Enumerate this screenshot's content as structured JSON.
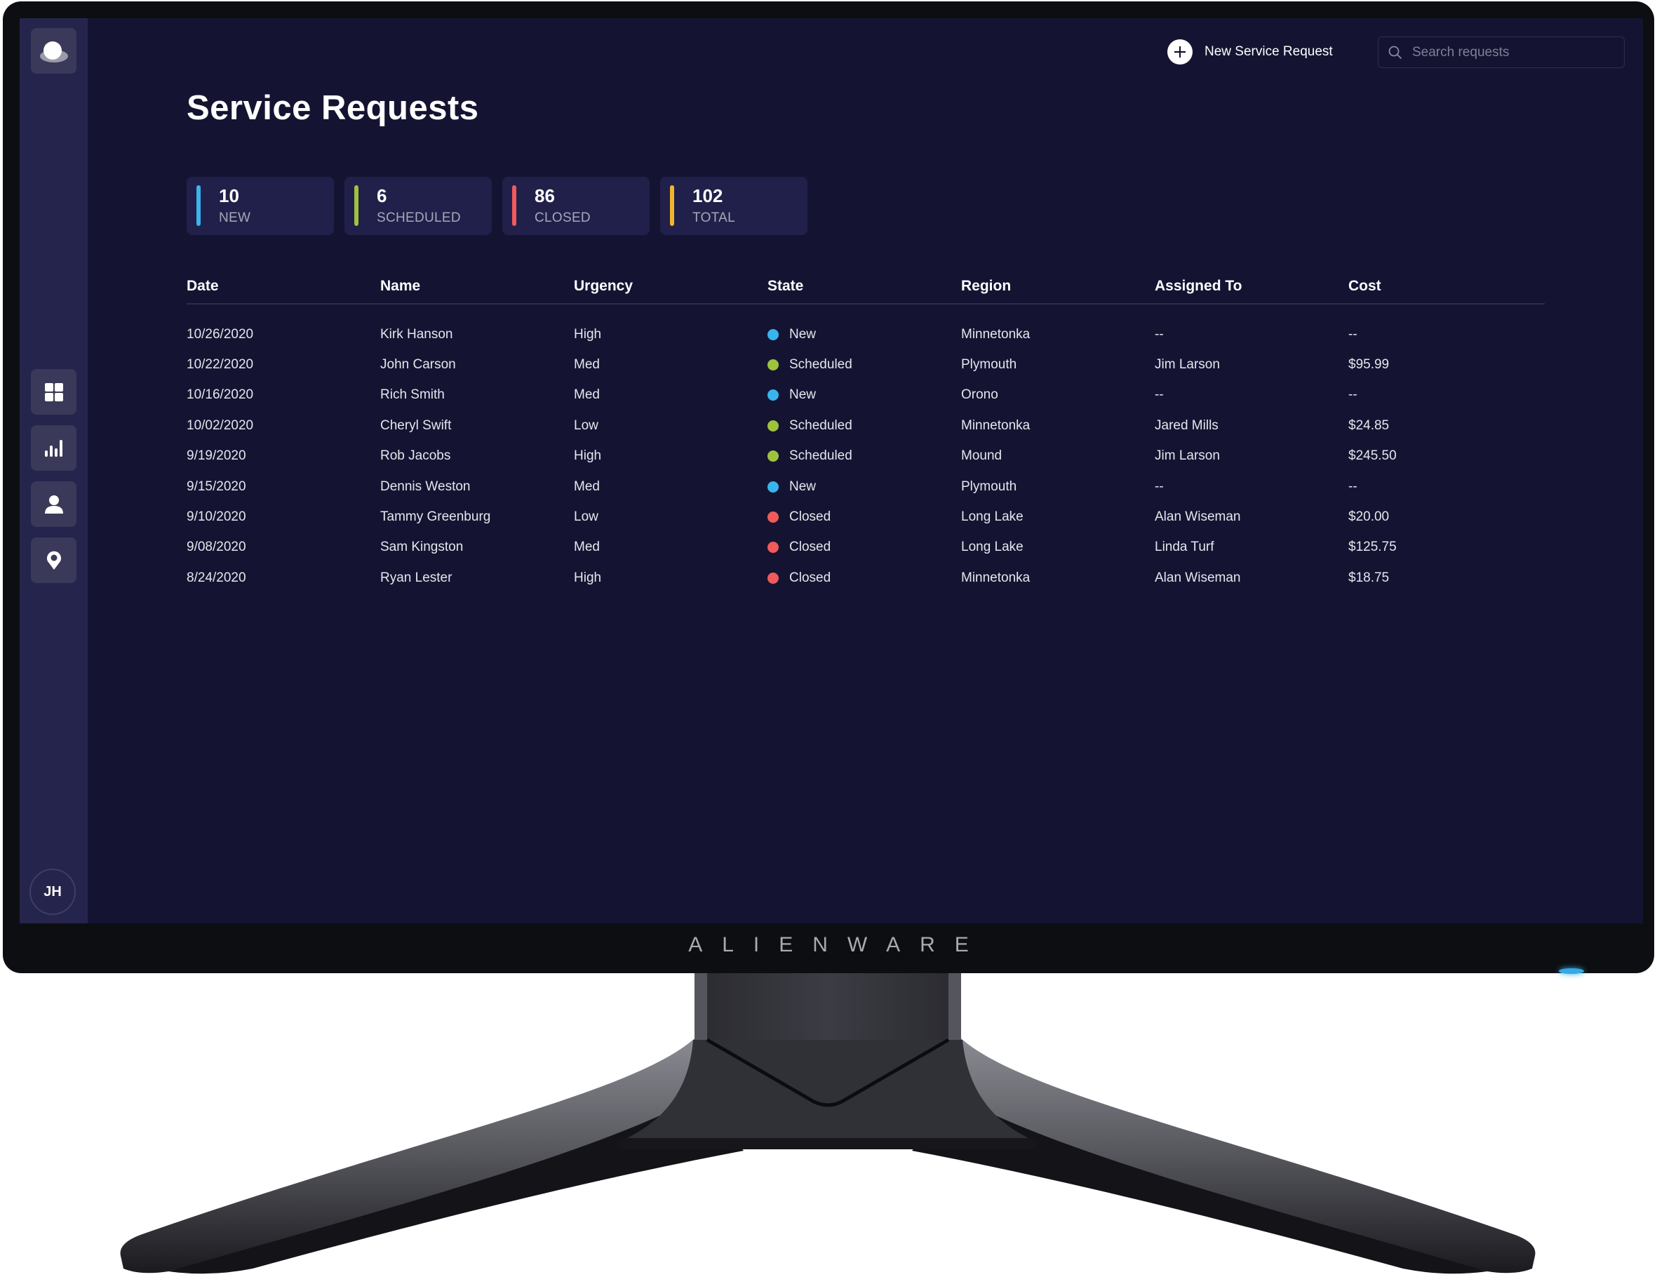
{
  "app": {
    "title": "Service Requests"
  },
  "header": {
    "new_request_label": "New Service Request",
    "search_placeholder": "Search requests",
    "search_value": ""
  },
  "sidebar": {
    "logo": "cloud-logo-icon",
    "items": [
      {
        "icon": "dashboard-grid-icon",
        "label": "Dashboard"
      },
      {
        "icon": "bar-chart-icon",
        "label": "Reports"
      },
      {
        "icon": "user-icon",
        "label": "Users"
      },
      {
        "icon": "location-pin-icon",
        "label": "Locations"
      }
    ],
    "avatar_initials": "JH"
  },
  "stats": [
    {
      "value": "10",
      "label": "NEW",
      "color": "#3ab4ec"
    },
    {
      "value": "6",
      "label": "SCHEDULED",
      "color": "#9ec23c"
    },
    {
      "value": "86",
      "label": "CLOSED",
      "color": "#ef5a5a"
    },
    {
      "value": "102",
      "label": "TOTAL",
      "color": "#f1b52c"
    }
  ],
  "state_colors": {
    "New": "#3ab4ec",
    "Scheduled": "#9ec23c",
    "Closed": "#ef5a5a"
  },
  "table": {
    "columns": [
      "Date",
      "Name",
      "Urgency",
      "State",
      "Region",
      "Assigned To",
      "Cost"
    ],
    "rows": [
      {
        "date": "10/26/2020",
        "name": "Kirk Hanson",
        "urgency": "High",
        "state": "New",
        "region": "Minnetonka",
        "assigned": "--",
        "cost": "--"
      },
      {
        "date": "10/22/2020",
        "name": "John Carson",
        "urgency": "Med",
        "state": "Scheduled",
        "region": "Plymouth",
        "assigned": "Jim Larson",
        "cost": "$95.99"
      },
      {
        "date": "10/16/2020",
        "name": "Rich Smith",
        "urgency": "Med",
        "state": "New",
        "region": "Orono",
        "assigned": "--",
        "cost": "--"
      },
      {
        "date": "10/02/2020",
        "name": "Cheryl Swift",
        "urgency": "Low",
        "state": "Scheduled",
        "region": "Minnetonka",
        "assigned": "Jared Mills",
        "cost": "$24.85"
      },
      {
        "date": "9/19/2020",
        "name": "Rob Jacobs",
        "urgency": "High",
        "state": "Scheduled",
        "region": "Mound",
        "assigned": "Jim Larson",
        "cost": "$245.50"
      },
      {
        "date": "9/15/2020",
        "name": "Dennis Weston",
        "urgency": "Med",
        "state": "New",
        "region": "Plymouth",
        "assigned": "--",
        "cost": "--"
      },
      {
        "date": "9/10/2020",
        "name": "Tammy Greenburg",
        "urgency": "Low",
        "state": "Closed",
        "region": "Long Lake",
        "assigned": "Alan Wiseman",
        "cost": "$20.00"
      },
      {
        "date": "9/08/2020",
        "name": "Sam Kingston",
        "urgency": "Med",
        "state": "Closed",
        "region": "Long Lake",
        "assigned": "Linda Turf",
        "cost": "$125.75"
      },
      {
        "date": "8/24/2020",
        "name": "Ryan Lester",
        "urgency": "High",
        "state": "Closed",
        "region": "Minnetonka",
        "assigned": "Alan Wiseman",
        "cost": "$18.75"
      }
    ]
  },
  "monitor": {
    "brand": "ALIENWARE"
  }
}
